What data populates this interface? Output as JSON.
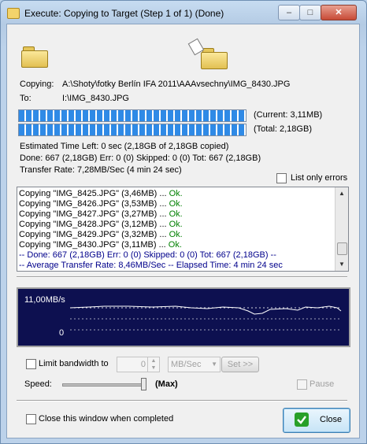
{
  "window": {
    "title": "Execute: Copying to Target (Step 1 of 1) (Done)"
  },
  "copy": {
    "copying_label": "Copying:",
    "copying_path": "A:\\Shoty\\fotky Berlín IFA 2011\\AAAvsechny\\IMG_8430.JPG",
    "to_label": "To:",
    "to_path": "I:\\IMG_8430.JPG",
    "current_text": "(Current: 3,11MB)",
    "total_text": "(Total: 2,18GB)",
    "current_progress": 1.0,
    "total_progress": 1.0
  },
  "stats": {
    "estimated": "Estimated Time Left: 0 sec (2,18GB of 2,18GB copied)",
    "done_line": "Done: 667 (2,18GB)  Err: 0 (0)  Skipped: 0 (0)  Tot: 667 (2,18GB)",
    "rate_line": "Transfer Rate: 7,28MB/Sec (4 min 24 sec)"
  },
  "list_only_errors": {
    "label": "List only errors",
    "checked": false
  },
  "log": [
    {
      "text": "Copying \"IMG_8425.JPG\"  (3,46MB) ... ",
      "status": "Ok."
    },
    {
      "text": "Copying \"IMG_8426.JPG\"  (3,53MB) ... ",
      "status": "Ok."
    },
    {
      "text": "Copying \"IMG_8427.JPG\"  (3,27MB) ... ",
      "status": "Ok."
    },
    {
      "text": "Copying \"IMG_8428.JPG\"  (3,12MB) ... ",
      "status": "Ok."
    },
    {
      "text": "Copying \"IMG_8429.JPG\"  (3,32MB) ... ",
      "status": "Ok."
    },
    {
      "text": "Copying \"IMG_8430.JPG\"  (3,11MB) ... ",
      "status": "Ok."
    }
  ],
  "log_summary": [
    "-- Done: 667 (2,18GB)  Err: 0 (0)  Skipped: 0 (0)  Tot: 667 (2,18GB) --",
    "-- Average Transfer Rate: 8,46MB/Sec -- Elapsed Time: 4 min 24 sec"
  ],
  "graph": {
    "max_label": "11,00MB/s",
    "min_label": "0"
  },
  "bandwidth": {
    "limit_label": "Limit bandwidth to",
    "value": "0",
    "unit": "MB/Sec",
    "set_button": "Set >>",
    "speed_label": "Speed:",
    "speed_value": "(Max)",
    "pause_label": "Pause"
  },
  "footer": {
    "close_when_completed": "Close this window when completed",
    "close_button": "Close"
  },
  "colors": {
    "progress": "#2f8ae6",
    "graph_bg": "#0d1050",
    "ok": "#008000"
  }
}
